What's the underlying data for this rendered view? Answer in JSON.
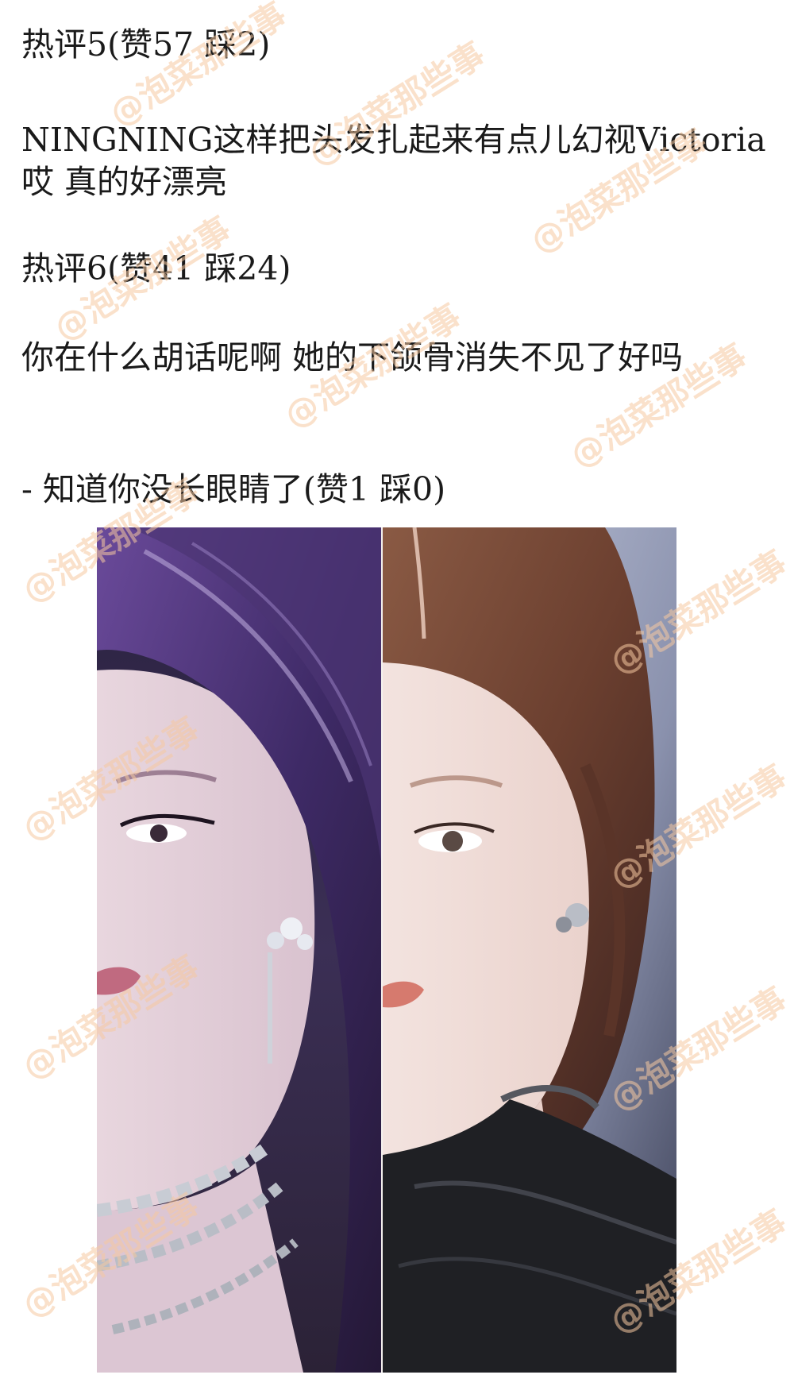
{
  "comment_5": {
    "header": "热评5(赞57 踩2)",
    "body": "NINGNING这样把头发扎起来有点儿幻视Victoria哎 真的好漂亮"
  },
  "comment_6": {
    "header": "热评6(赞41 踩24)",
    "body": "你在什么胡话呢啊 她的下颌骨消失不见了好吗"
  },
  "reply": {
    "text": "- 知道你没长眼睛了(赞1 踩0)"
  },
  "image": {
    "left_panel": "photo of woman with dark purple hair, silver chain necklace",
    "right_panel": "photo of woman with auburn hair pulled back, black leather jacket"
  },
  "watermark": {
    "text": "@泡菜那些事",
    "color": "#f5c9a0"
  },
  "colors": {
    "text": "#1a1a1a",
    "background": "#ffffff"
  }
}
